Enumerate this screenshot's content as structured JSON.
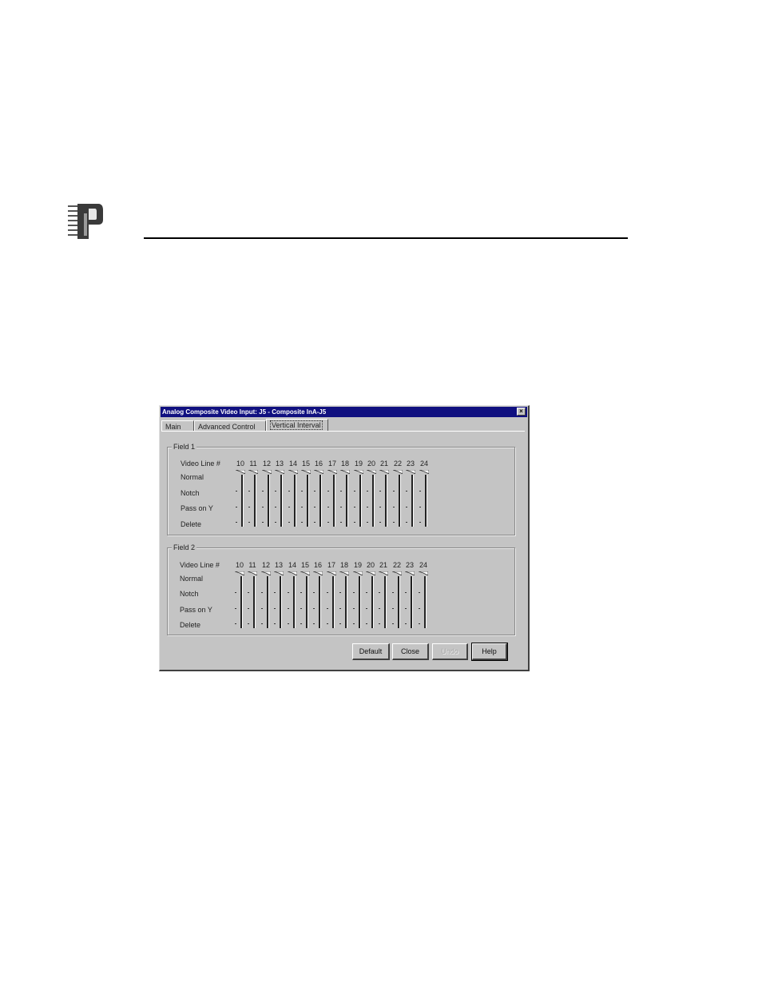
{
  "dialog": {
    "title": "Analog Composite Video Input: J5 - Composite InA-J5",
    "close_glyph": "×"
  },
  "tabs": [
    {
      "label": "Main",
      "active": false
    },
    {
      "label": "Advanced Control",
      "active": false
    },
    {
      "label": "Vertical Interval",
      "active": true
    }
  ],
  "fields": [
    {
      "label": "Field 1",
      "row_labels": [
        "Video Line #",
        "Normal",
        "Notch",
        "Pass on Y",
        "Delete"
      ],
      "lines": [
        "10",
        "11",
        "12",
        "13",
        "14",
        "15",
        "16",
        "17",
        "18",
        "19",
        "20",
        "21",
        "22",
        "23",
        "24"
      ],
      "setting": "Normal"
    },
    {
      "label": "Field 2",
      "row_labels": [
        "Video Line #",
        "Normal",
        "Notch",
        "Pass on Y",
        "Delete"
      ],
      "lines": [
        "10",
        "11",
        "12",
        "13",
        "14",
        "15",
        "16",
        "17",
        "18",
        "19",
        "20",
        "21",
        "22",
        "23",
        "24"
      ],
      "setting": "Normal"
    }
  ],
  "buttons": {
    "default_label": "Default",
    "close_label": "Close",
    "undo_label": "Undo",
    "help_label": "Help"
  },
  "colors": {
    "titlebar": "#101080",
    "dialog_face": "#c4c4c4"
  },
  "icons": {
    "logo": "p-logo-icon",
    "close": "close-icon"
  }
}
